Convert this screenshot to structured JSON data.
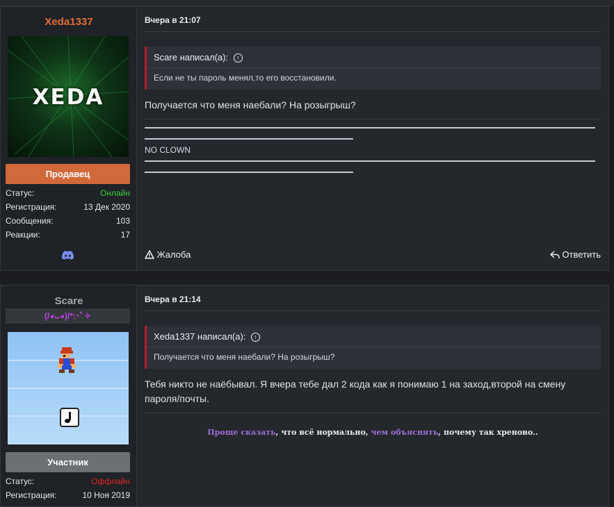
{
  "posts": [
    {
      "username": "Xeda1337",
      "username_color": "#e46c39",
      "avatar_text": "XEDA",
      "rank": "Продавец",
      "rank_color": "#d2693a",
      "stats": [
        {
          "label": "Статус:",
          "value": "Онлайн",
          "color": "#3fd03f"
        },
        {
          "label": "Регистрация:",
          "value": "13 Дек 2020"
        },
        {
          "label": "Сообщения:",
          "value": "103"
        },
        {
          "label": "Реакции:",
          "value": "17"
        }
      ],
      "contact_icon": "discord-icon",
      "date": "Вчера в 21:07",
      "quote": {
        "header": "Scare написал(а):",
        "text": "Если не ты пароль менял,то его восстановили."
      },
      "message": "Получается что меня наебали? На розыгрыш?",
      "signature_text": "NO CLOWN",
      "actions": {
        "report": "Жалоба",
        "reply": "Ответить"
      }
    },
    {
      "username": "Scare",
      "username_color": "#a4a8ad",
      "user_title": "(/◕ᴗ◕)/*:･ﾟ✧",
      "rank": "Участник",
      "rank_color": "#6c6f73",
      "stats": [
        {
          "label": "Статус:",
          "value": "Оффлайн",
          "color": "#e02424"
        },
        {
          "label": "Регистрация:",
          "value": "10 Ноя 2019"
        }
      ],
      "date": "Вчера в 21:14",
      "quote": {
        "header": "Xeda1337 написал(а):",
        "text": "Получается что меня наебали? На розыгрыш?"
      },
      "message": "Тебя никто не наёбывал. Я вчера тебе дал 2 кода как я понимаю 1 на заход,второй на смену пароля/почты.",
      "signature": [
        {
          "text": "Проще сказать",
          "accent": true
        },
        {
          "text": ", что всё нормально, ",
          "accent": false
        },
        {
          "text": "чем объяснять",
          "accent": true
        },
        {
          "text": ", почему так хреново..",
          "accent": false
        }
      ]
    }
  ]
}
